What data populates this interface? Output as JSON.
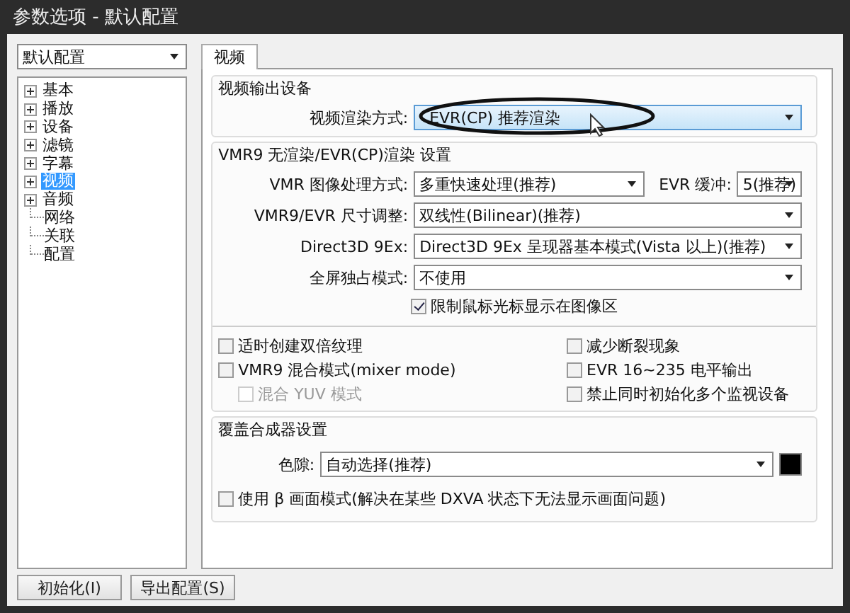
{
  "window": {
    "title": "参数选项 - 默认配置"
  },
  "profile_select": {
    "value": "默认配置"
  },
  "tree": [
    {
      "label": "基本",
      "expandable": true,
      "selected": false
    },
    {
      "label": "播放",
      "expandable": true,
      "selected": false
    },
    {
      "label": "设备",
      "expandable": true,
      "selected": false
    },
    {
      "label": "滤镜",
      "expandable": true,
      "selected": false
    },
    {
      "label": "字幕",
      "expandable": true,
      "selected": false
    },
    {
      "label": "视频",
      "expandable": true,
      "selected": true
    },
    {
      "label": "音频",
      "expandable": true,
      "selected": false
    },
    {
      "label": "网络",
      "expandable": false,
      "selected": false
    },
    {
      "label": "关联",
      "expandable": false,
      "selected": false
    },
    {
      "label": "配置",
      "expandable": false,
      "selected": false
    }
  ],
  "tabs": [
    {
      "label": "视频",
      "selected": true
    }
  ],
  "output_group": {
    "title": "视频输出设备",
    "renderer": {
      "label": "视频渲染方式:",
      "value": "EVR(CP) 推荐渲染"
    }
  },
  "vmr_group": {
    "title": "VMR9 无渲染/EVR(CP)渲染 设置",
    "image_processing": {
      "label": "VMR 图像处理方式:",
      "value": "多重快速处理(推荐)"
    },
    "evr_buffer": {
      "label": "EVR 缓冲:",
      "value": "5(推荐)"
    },
    "resize": {
      "label": "VMR9/EVR 尺寸调整:",
      "value": "双线性(Bilinear)(推荐)"
    },
    "d3d9ex": {
      "label": "Direct3D 9Ex:",
      "value": "Direct3D 9Ex 呈现器基本模式(Vista 以上)(推荐)"
    },
    "fullscreen": {
      "label": "全屏独占模式:",
      "value": "不使用"
    },
    "limit_cursor": {
      "label": "限制鼠标光标显示在图像区",
      "checked": true
    },
    "left_options": [
      {
        "label": "适时创建双倍纹理",
        "checked": false,
        "disabled": false
      },
      {
        "label": "VMR9 混合模式(mixer mode)",
        "checked": false,
        "disabled": false
      },
      {
        "label": "混合 YUV 模式",
        "checked": false,
        "disabled": true
      }
    ],
    "right_options": [
      {
        "label": "减少断裂现象",
        "checked": false,
        "disabled": false
      },
      {
        "label": "EVR 16~235 电平输出",
        "checked": false,
        "disabled": false
      },
      {
        "label": "禁止同时初始化多个监视设备",
        "checked": false,
        "disabled": false
      }
    ]
  },
  "compositor_group": {
    "title": "覆盖合成器设置",
    "color": {
      "label": "色隙:",
      "value": "自动选择(推荐)"
    },
    "beta_mode": {
      "label": "使用 β 画面模式(解决在某些 DXVA 状态下无法显示画面问题)",
      "checked": false
    }
  },
  "buttons": [
    "初始化(I)",
    "导出配置(S)"
  ]
}
